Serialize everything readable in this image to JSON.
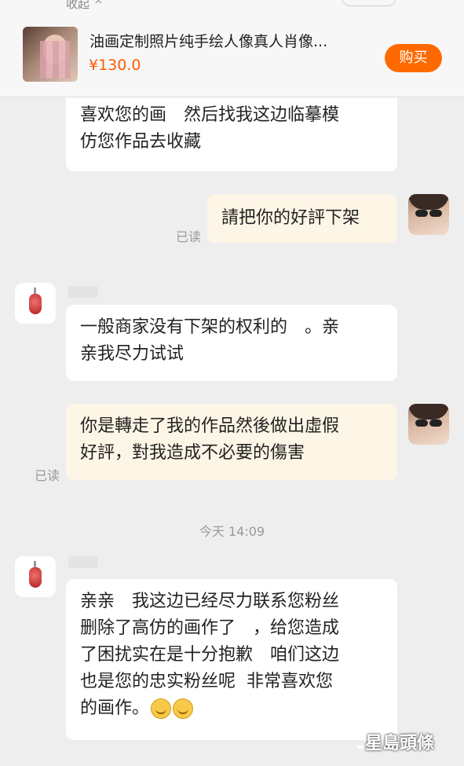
{
  "header": {
    "collapse_label": "收起",
    "product_title": "油画定制照片纯手绘人像真人肖像...",
    "price": "¥130.0",
    "buy_label": "购买"
  },
  "messages": [
    {
      "side": "in",
      "text": "喜欢您的画　然后找我这边临摹模\n仿您作品去收藏"
    },
    {
      "side": "out",
      "text": "請把你的好評下架",
      "status": "已读"
    },
    {
      "side": "in",
      "text": "一般商家没有下架的权利的　。亲\n亲我尽力试试"
    },
    {
      "side": "out",
      "text": "你是轉走了我的作品然後做出虛假\n好評，對我造成不必要的傷害",
      "status": "已读"
    },
    {
      "side": "in",
      "text": "亲亲　我这边已经尽力联系您粉丝\n删除了高仿的画作了　，给您造成\n了困扰实在是十分抱歉　咱们这边\n也是您的忠实粉丝呢  非常喜欢您\n的画作。"
    }
  ],
  "timestamp": "今天 14:09",
  "watermark": "星島頭條",
  "colors": {
    "accent": "#ff6a00",
    "price": "#ff5a00",
    "outgoing_bubble": "#fdf5e6"
  }
}
